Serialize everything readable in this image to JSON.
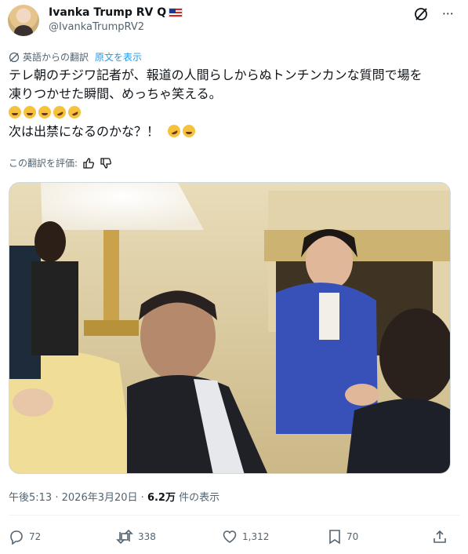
{
  "author": {
    "name": "Ivanka Trump RV Q",
    "handle": "@IvankaTrumpRV2"
  },
  "translation": {
    "label": "英語からの翻訳",
    "show_original": "原文を表示"
  },
  "tweet": {
    "line1": "テレ朝のチジワ記者が、報道の人間らしからぬトンチンカンな質問で場を",
    "line2": "凍りつかせた瞬間、めっちゃ笑える。",
    "line4": "次は出禁になるのかな？！"
  },
  "rate_translation": "この翻訳を評価:",
  "meta": {
    "time": "午後5:13",
    "separator": "·",
    "date": "2026年3月20日",
    "views_count": "6.2万",
    "views_label": "件の表示"
  },
  "actions": {
    "replies": "72",
    "reposts": "338",
    "likes": "1,312",
    "bookmarks": "70"
  },
  "icons": [
    "grok-icon",
    "more-icon",
    "translate-icon",
    "thumbs-up-icon",
    "thumbs-down-icon",
    "reply-icon",
    "repost-icon",
    "like-icon",
    "bookmark-icon",
    "share-icon"
  ],
  "colors": {
    "link": "#1d9bf0",
    "secondary": "#536471",
    "text": "#0f1419"
  }
}
